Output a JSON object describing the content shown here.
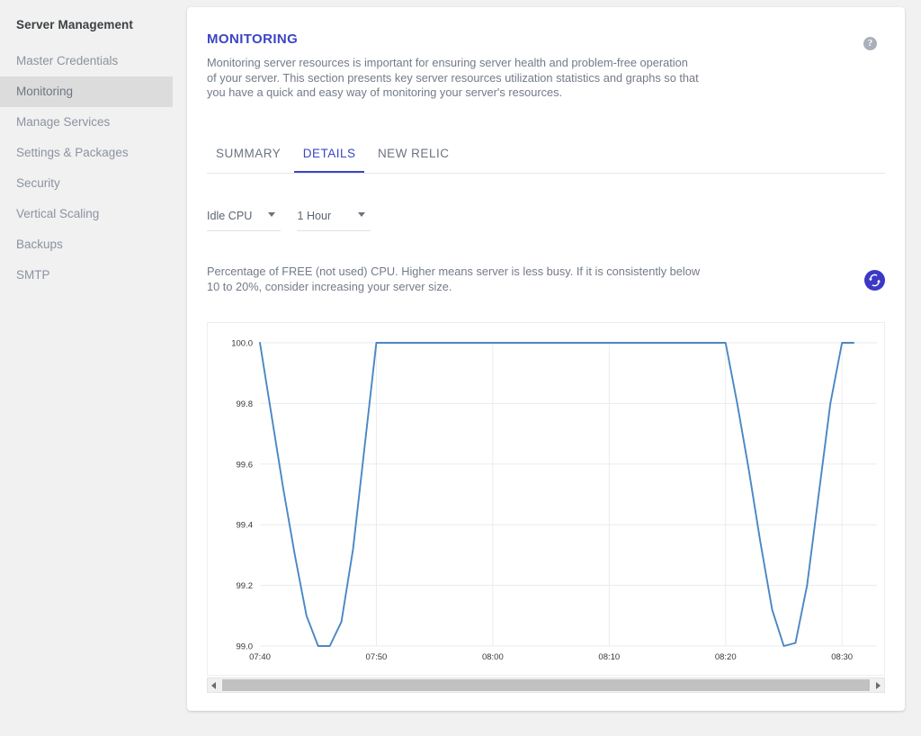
{
  "sidebar": {
    "title": "Server Management",
    "items": [
      {
        "label": "Master Credentials",
        "active": false
      },
      {
        "label": "Monitoring",
        "active": true
      },
      {
        "label": "Manage Services",
        "active": false
      },
      {
        "label": "Settings & Packages",
        "active": false
      },
      {
        "label": "Security",
        "active": false
      },
      {
        "label": "Vertical Scaling",
        "active": false
      },
      {
        "label": "Backups",
        "active": false
      },
      {
        "label": "SMTP",
        "active": false
      }
    ]
  },
  "header": {
    "title": "MONITORING",
    "description": "Monitoring server resources is important for ensuring server health and problem-free operation of your server. This section presents key server resources utilization statistics and graphs so that you have a quick and easy way of monitoring your server's resources.",
    "help_icon": "question-mark-circle-icon",
    "help_glyph": "?"
  },
  "tabs": [
    {
      "label": "SUMMARY",
      "active": false
    },
    {
      "label": "DETAILS",
      "active": true
    },
    {
      "label": "NEW RELIC",
      "active": false
    }
  ],
  "controls": {
    "metric_select": {
      "value": "Idle CPU",
      "icon": "chevron-down-icon"
    },
    "range_select": {
      "value": "1 Hour",
      "icon": "chevron-down-icon"
    }
  },
  "metric_note": "Percentage of FREE (not used) CPU. Higher means server is less busy. If it is consistently below 10 to 20%, consider increasing your server size.",
  "refresh_button": {
    "icon": "refresh-icon",
    "color": "#3b39c4"
  },
  "scrollbar": {
    "left_arrow_icon": "arrow-left-icon",
    "right_arrow_icon": "arrow-right-icon"
  },
  "colors": {
    "accent": "#3b45c4",
    "line": "#4a87c4",
    "sidebar_active_bg": "#dcdcdc",
    "page_bg": "#f1f1f1",
    "muted_text": "#737b88"
  },
  "chart_data": {
    "type": "line",
    "title": "",
    "xlabel": "",
    "ylabel": "",
    "ylim": [
      99.0,
      100.0
    ],
    "yticks": [
      "99.0",
      "99.2",
      "99.4",
      "99.6",
      "99.8",
      "100.0"
    ],
    "xticks": [
      "07:40",
      "07:50",
      "08:00",
      "08:10",
      "08:20",
      "08:30"
    ],
    "grid": true,
    "legend": "none",
    "series": [
      {
        "name": "Idle CPU",
        "color": "#4a87c4",
        "x": [
          "07:40",
          "07:41",
          "07:42",
          "07:43",
          "07:44",
          "07:45",
          "07:46",
          "07:47",
          "07:48",
          "07:49",
          "07:50",
          "07:55",
          "08:00",
          "08:05",
          "08:10",
          "08:15",
          "08:20",
          "08:21",
          "08:22",
          "08:23",
          "08:24",
          "08:25",
          "08:26",
          "08:27",
          "08:28",
          "08:29",
          "08:30",
          "08:31"
        ],
        "values": [
          100.0,
          99.76,
          99.52,
          99.3,
          99.1,
          99.0,
          99.0,
          99.08,
          99.32,
          99.66,
          100.0,
          100.0,
          100.0,
          100.0,
          100.0,
          100.0,
          100.0,
          99.8,
          99.58,
          99.34,
          99.12,
          99.0,
          99.01,
          99.2,
          99.5,
          99.8,
          100.0,
          100.0
        ]
      }
    ]
  }
}
